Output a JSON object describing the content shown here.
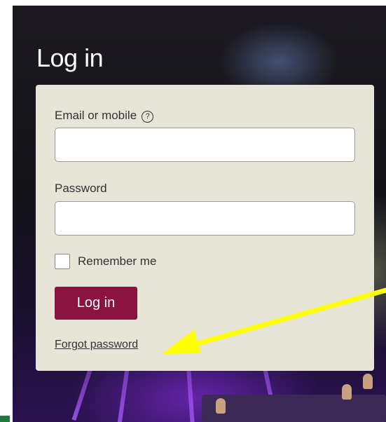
{
  "page": {
    "title": "Log in"
  },
  "form": {
    "email_label": "Email or mobile",
    "email_value": "",
    "help_glyph": "?",
    "password_label": "Password",
    "password_value": "",
    "remember_label": "Remember me",
    "remember_checked": false,
    "submit_label": "Log in",
    "forgot_label": "Forgot password"
  },
  "colors": {
    "card_bg": "#e7e4d8",
    "primary_button": "#8c1240",
    "annotation_arrow": "#ffff00"
  }
}
